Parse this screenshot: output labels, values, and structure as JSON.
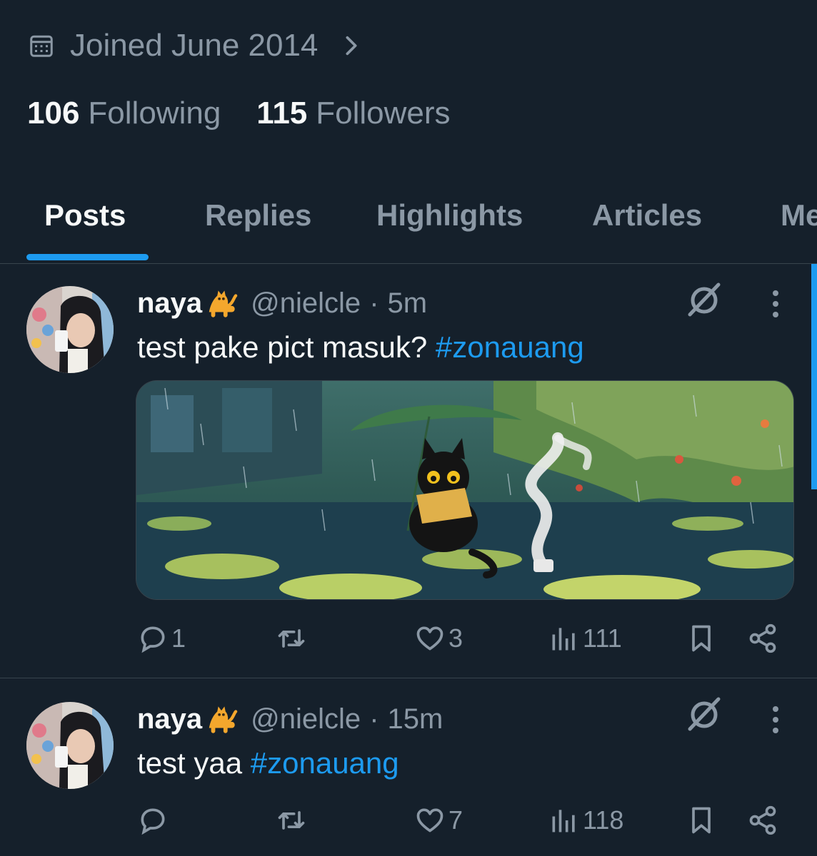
{
  "profile": {
    "joined": "Joined June 2014",
    "following_count": "106",
    "following_label": "Following",
    "followers_count": "115",
    "followers_label": "Followers"
  },
  "tabs": [
    {
      "label": "Posts",
      "active": true
    },
    {
      "label": "Replies"
    },
    {
      "label": "Highlights"
    },
    {
      "label": "Articles"
    },
    {
      "label": "Me"
    }
  ],
  "posts": [
    {
      "name": "naya",
      "emoji": "cat-emoji",
      "handle": "@nielcle",
      "separator": "·",
      "time": "5m",
      "text": "test pake pict masuk? ",
      "hashtag": "#zonauang",
      "has_media": true,
      "replies": "1",
      "reposts": "",
      "likes": "3",
      "views": "111"
    },
    {
      "name": "naya",
      "emoji": "cat-emoji",
      "handle": "@nielcle",
      "separator": "·",
      "time": "15m",
      "text": "test yaa ",
      "hashtag": "#zonauang",
      "has_media": false,
      "replies": "",
      "reposts": "",
      "likes": "7",
      "views": "118"
    }
  ],
  "colors": {
    "background": "#15202b",
    "accent": "#1d9bf0",
    "muted": "#8b98a5",
    "divider": "#38444d"
  }
}
